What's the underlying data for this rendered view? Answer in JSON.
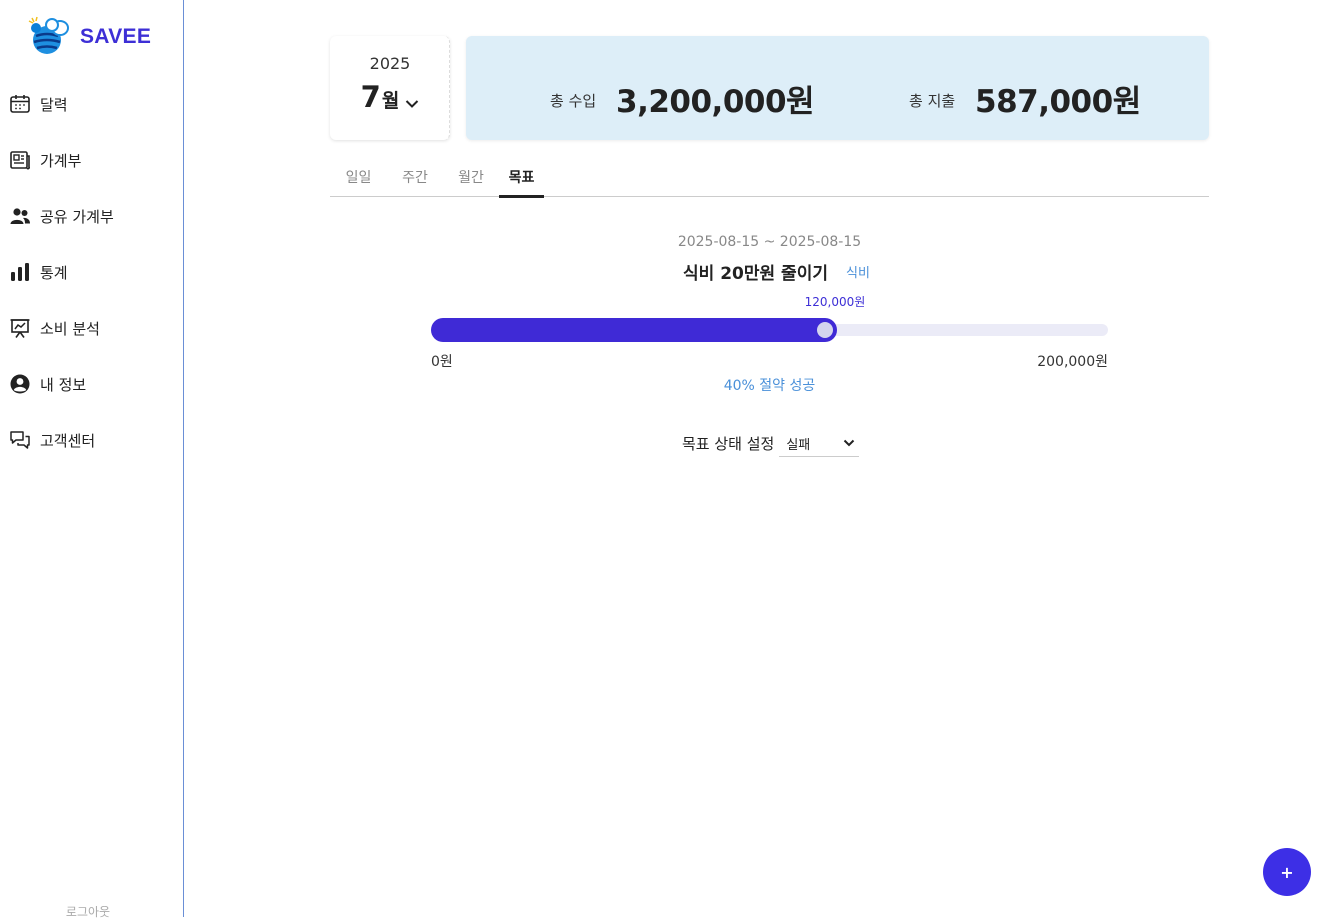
{
  "app": {
    "name": "SAVEE",
    "brand_color": "#3d2fd6"
  },
  "sidebar": {
    "items": [
      {
        "label": "달력",
        "icon": "calendar-icon"
      },
      {
        "label": "가계부",
        "icon": "ledger-icon"
      },
      {
        "label": "공유 가계부",
        "icon": "users-icon"
      },
      {
        "label": "통계",
        "icon": "bar-chart-icon"
      },
      {
        "label": "소비 분석",
        "icon": "analysis-icon"
      },
      {
        "label": "내 정보",
        "icon": "user-circle-icon"
      },
      {
        "label": "고객센터",
        "icon": "chat-icon"
      }
    ],
    "logout": "로그아웃"
  },
  "period": {
    "year": "2025",
    "month": "7",
    "month_unit": "월"
  },
  "summary": {
    "income_label": "총 수입",
    "income_value": "3,200,000원",
    "expense_label": "총 지출",
    "expense_value": "587,000원"
  },
  "tabs": [
    "일일",
    "주간",
    "월간",
    "목표"
  ],
  "active_tab": "목표",
  "goal": {
    "dates": "2025-08-15 ~ 2025-08-15",
    "title": "식비 20만원 줄이기",
    "category": "식비",
    "current": "120,000원",
    "current_label": "120,000원",
    "min_label": "0원",
    "max_label": "200,000원",
    "progress": 0.6,
    "status_text": "40% 절약 성공",
    "state_label": "목표 상태 설정",
    "state_value": "실패"
  },
  "fab": {
    "label": "+"
  }
}
